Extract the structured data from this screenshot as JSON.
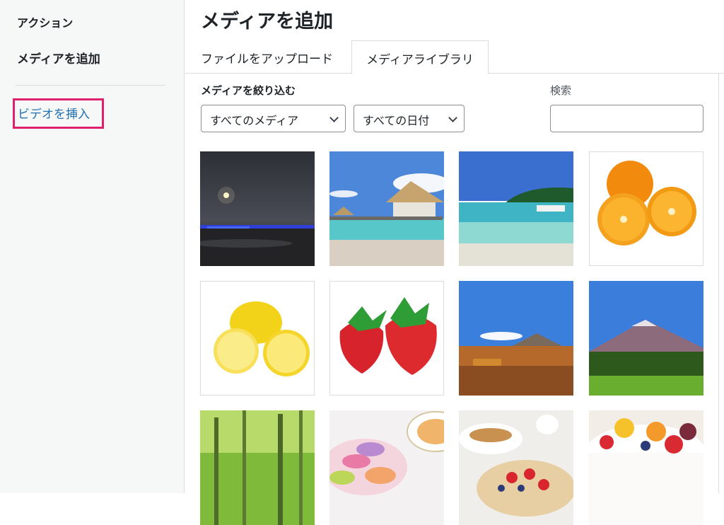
{
  "sidebar": {
    "heading": "アクション",
    "add_media": "メディアを追加",
    "insert_video": "ビデオを挿入"
  },
  "main": {
    "title": "メディアを追加",
    "tabs": [
      {
        "label": "ファイルをアップロード",
        "active": false
      },
      {
        "label": "メディアライブラリ",
        "active": true
      }
    ],
    "filter_label": "メディアを絞り込む",
    "filter_type": "すべてのメディア",
    "filter_date": "すべての日付",
    "search_label": "検索",
    "search_value": ""
  },
  "accent_colors": {
    "highlight_border": "#e0206c",
    "link": "#2271b1"
  },
  "media_items": [
    {
      "subject": "moonlit-beach"
    },
    {
      "subject": "overwater-bungalow"
    },
    {
      "subject": "tropical-island-boat"
    },
    {
      "subject": "oranges"
    },
    {
      "subject": "lemons"
    },
    {
      "subject": "strawberries"
    },
    {
      "subject": "autumn-mountain"
    },
    {
      "subject": "mount-fuji-style-peak"
    },
    {
      "subject": "green-forest"
    },
    {
      "subject": "macarons-tea"
    },
    {
      "subject": "tea-cup-berry-tart"
    },
    {
      "subject": "fruit-cake"
    }
  ]
}
